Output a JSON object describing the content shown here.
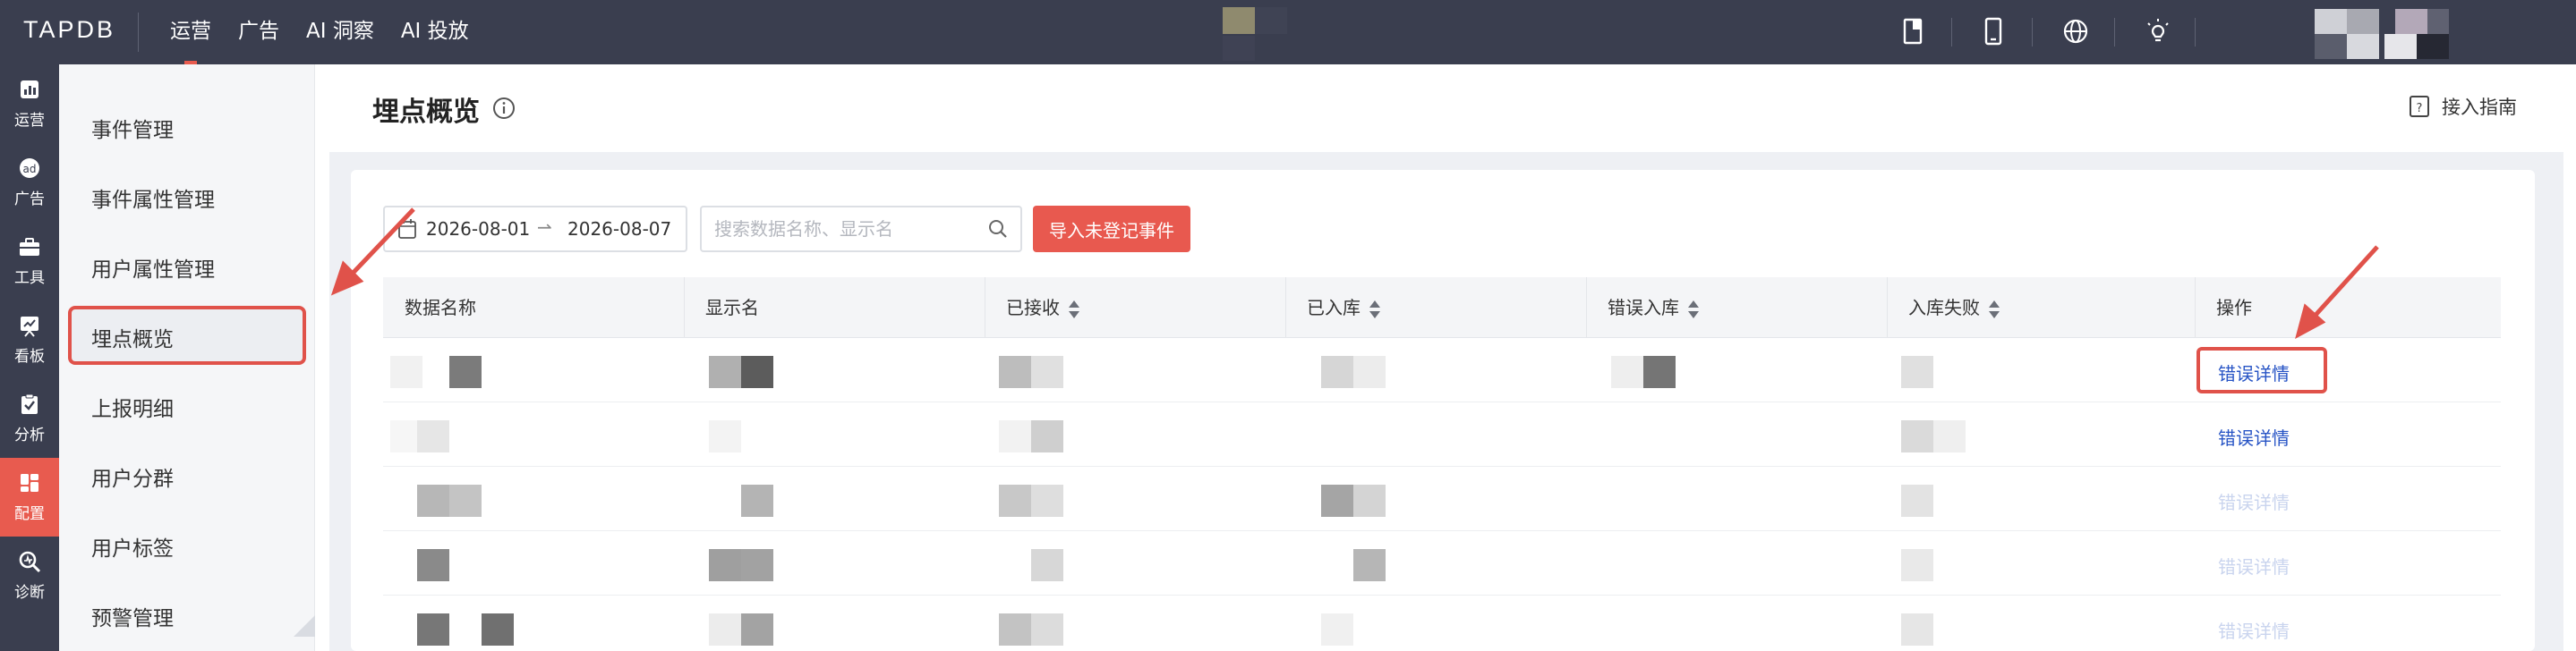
{
  "app": {
    "logo": "TAPDB"
  },
  "topnav": [
    {
      "label": "运营",
      "active": true
    },
    {
      "label": "广告",
      "active": false
    },
    {
      "label": "AI 洞察",
      "active": false
    },
    {
      "label": "AI 投放",
      "active": false
    }
  ],
  "topbar_icons": [
    "document-icon",
    "mobile-icon",
    "globe-icon",
    "bulb-icon"
  ],
  "rail": [
    {
      "label": "运营",
      "icon": "chart-icon",
      "active": false
    },
    {
      "label": "广告",
      "icon": "ad-icon",
      "active": false
    },
    {
      "label": "工具",
      "icon": "toolbox-icon",
      "active": false
    },
    {
      "label": "看板",
      "icon": "board-icon",
      "active": false
    },
    {
      "label": "分析",
      "icon": "clipboard-icon",
      "active": false
    },
    {
      "label": "配置",
      "icon": "grid-icon",
      "active": true
    },
    {
      "label": "诊断",
      "icon": "diagnose-icon",
      "active": false
    }
  ],
  "submenu": [
    {
      "label": "事件管理",
      "active": false
    },
    {
      "label": "事件属性管理",
      "active": false
    },
    {
      "label": "用户属性管理",
      "active": false
    },
    {
      "label": "埋点概览",
      "active": true
    },
    {
      "label": "上报明细",
      "active": false
    },
    {
      "label": "用户分群",
      "active": false
    },
    {
      "label": "用户标签",
      "active": false
    },
    {
      "label": "预警管理",
      "active": false
    }
  ],
  "page": {
    "title": "埋点概览",
    "guide_label": "接入指南"
  },
  "filters": {
    "date_start": "2026-08-01",
    "date_end": "2026-08-07",
    "search_placeholder": "搜索数据名称、显示名",
    "import_button": "导入未登记事件"
  },
  "table": {
    "columns": [
      {
        "label": "数据名称",
        "sortable": false
      },
      {
        "label": "显示名",
        "sortable": false
      },
      {
        "label": "已接收",
        "sortable": true
      },
      {
        "label": "已入库",
        "sortable": true
      },
      {
        "label": "错误入库",
        "sortable": true
      },
      {
        "label": "入库失败",
        "sortable": true
      },
      {
        "label": "操作",
        "sortable": false
      }
    ],
    "rows": [
      {
        "action": "错误详情",
        "action_enabled": true,
        "highlighted": true
      },
      {
        "action": "错误详情",
        "action_enabled": true,
        "highlighted": false
      },
      {
        "action": "错误详情",
        "action_enabled": false,
        "highlighted": false
      },
      {
        "action": "错误详情",
        "action_enabled": false,
        "highlighted": false
      },
      {
        "action": "错误详情",
        "action_enabled": false,
        "highlighted": false
      }
    ]
  },
  "colors": {
    "topbar": "#3a3e4f",
    "accent": "#e85b4f",
    "link": "#2754c5",
    "link_disabled": "#c9d4ee",
    "annotation": "#e0524a"
  }
}
